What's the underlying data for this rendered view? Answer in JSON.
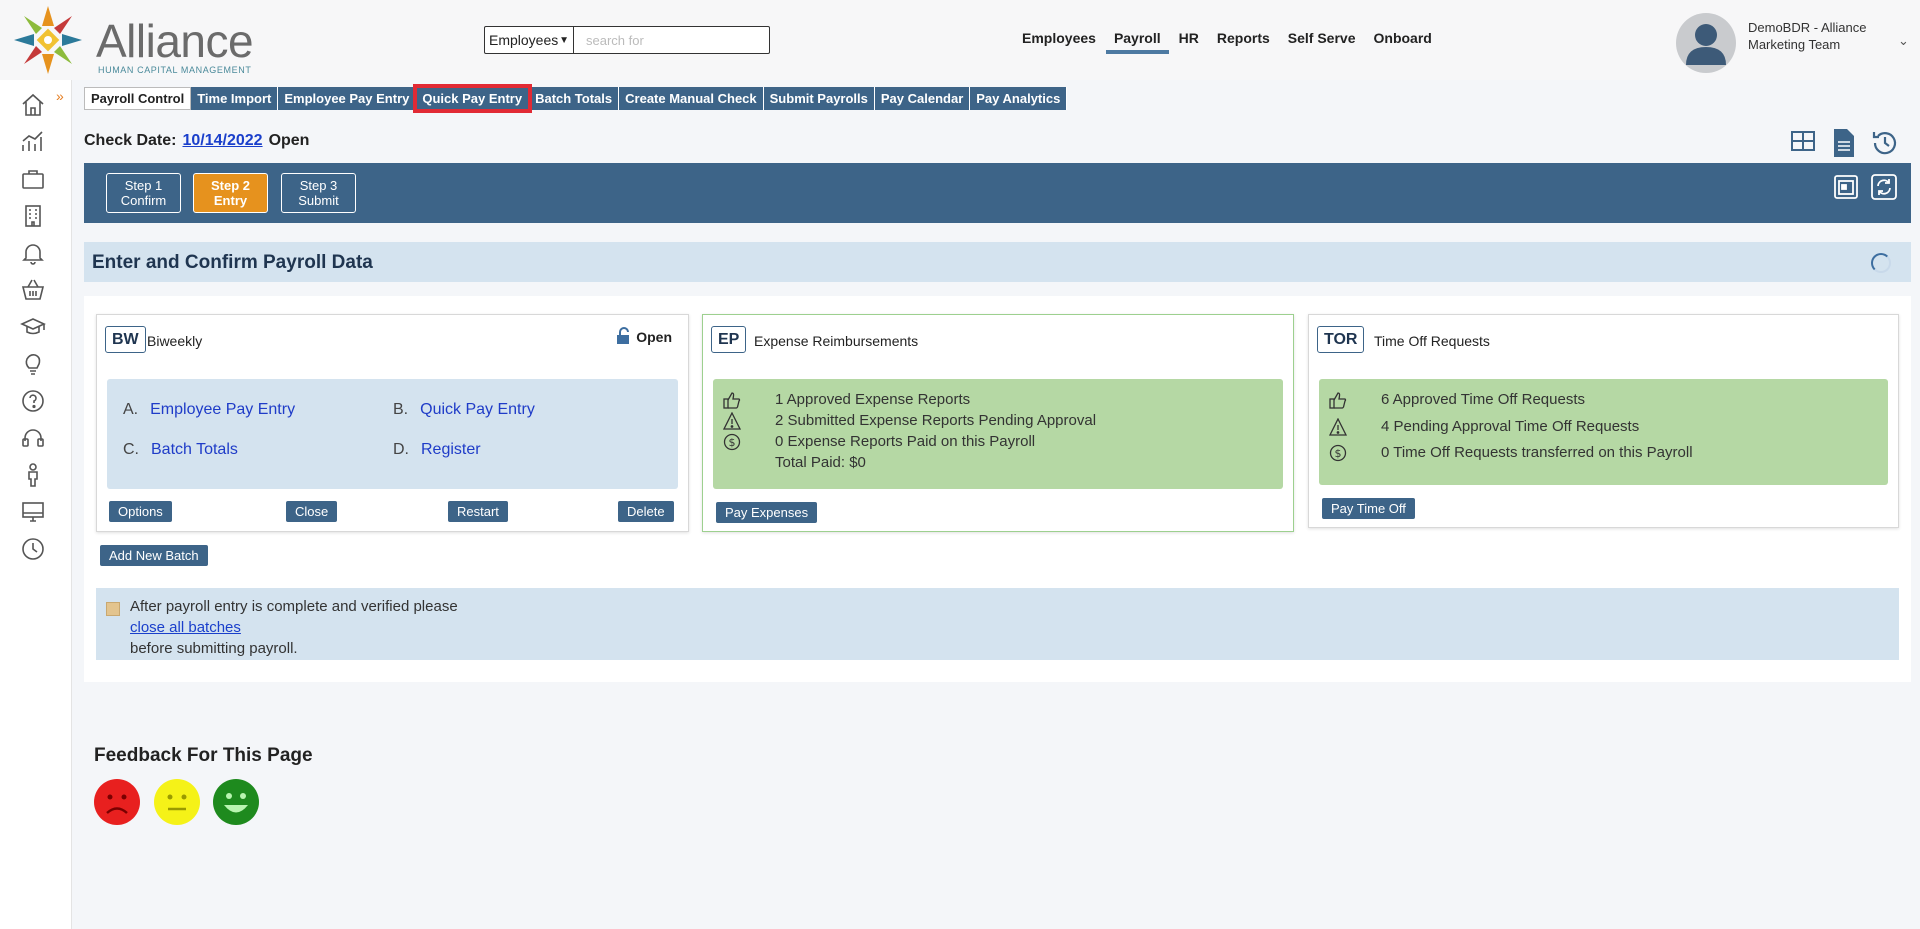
{
  "app": {
    "brand": "Alliance",
    "tagline": "HUMAN CAPITAL MANAGEMENT"
  },
  "search": {
    "scope": "Employees",
    "placeholder": "search for"
  },
  "topnav": [
    "Employees",
    "Payroll",
    "HR",
    "Reports",
    "Self Serve",
    "Onboard"
  ],
  "user": {
    "name": "DemoBDR - Alliance Marketing Team"
  },
  "tabs": [
    "Payroll Control",
    "Time Import",
    "Employee Pay Entry",
    "Quick Pay Entry",
    "Batch Totals",
    "Create Manual Check",
    "Submit Payrolls",
    "Pay Calendar",
    "Pay Analytics"
  ],
  "check": {
    "label": "Check Date:",
    "date": "10/14/2022",
    "status": "Open"
  },
  "steps": [
    {
      "line1": "Step 1",
      "line2": "Confirm"
    },
    {
      "line1": "Step 2",
      "line2": "Entry"
    },
    {
      "line1": "Step 3",
      "line2": "Submit"
    }
  ],
  "section": {
    "title": "Enter and Confirm Payroll Data"
  },
  "batch": {
    "code": "BW",
    "name": "Biweekly",
    "status": "Open",
    "links": [
      {
        "letter": "A.",
        "label": "Employee Pay Entry"
      },
      {
        "letter": "B.",
        "label": "Quick Pay Entry"
      },
      {
        "letter": "C.",
        "label": "Batch Totals"
      },
      {
        "letter": "D.",
        "label": "Register"
      }
    ],
    "buttons": {
      "options": "Options",
      "close": "Close",
      "restart": "Restart",
      "delete": "Delete"
    }
  },
  "expenses": {
    "code": "EP",
    "title": "Expense Reimbursements",
    "lines": [
      "1 Approved Expense Reports",
      "2 Submitted Expense Reports Pending Approval",
      "0 Expense Reports Paid on this Payroll",
      "Total Paid: $0"
    ],
    "button": "Pay Expenses"
  },
  "timeoff": {
    "code": "TOR",
    "title": "Time Off Requests",
    "lines": [
      "6 Approved Time Off Requests",
      "4 Pending Approval Time Off Requests",
      "0 Time Off Requests transferred on this Payroll"
    ],
    "button": "Pay Time Off"
  },
  "add_batch": "Add New Batch",
  "notice": {
    "line1": "After payroll entry is complete and verified please",
    "link": "close all batches",
    "line3": "before submitting payroll."
  },
  "feedback": {
    "title": "Feedback For This Page"
  },
  "colors": {
    "nav_blue": "#3d6488",
    "active_step": "#e6921e",
    "highlight": "#e12a35",
    "green_panel": "#b5d8a4",
    "blue_panel": "#d4e3ef"
  }
}
